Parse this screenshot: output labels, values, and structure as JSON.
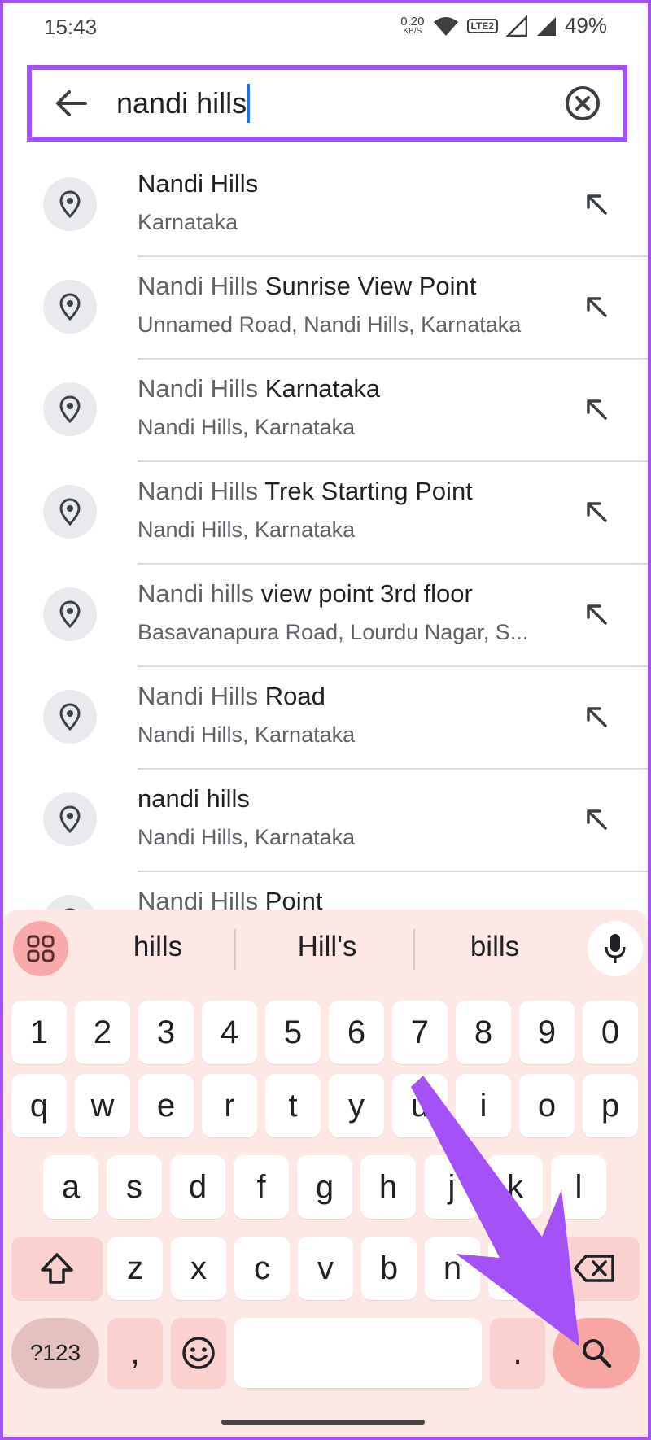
{
  "status_bar": {
    "time": "15:43",
    "net_speed": "0.20",
    "net_unit": "KB/S",
    "volte_label": "LTE2",
    "battery": "49%"
  },
  "search": {
    "query": "nandi hills"
  },
  "results": [
    {
      "match": "",
      "title": "Nandi Hills",
      "subtitle": "Karnataka"
    },
    {
      "match": "Nandi Hills",
      "title": " Sunrise View Point",
      "subtitle": "Unnamed Road, Nandi Hills, Karnataka"
    },
    {
      "match": "Nandi Hills",
      "title": " Karnataka",
      "subtitle": "Nandi Hills, Karnataka"
    },
    {
      "match": "Nandi Hills",
      "title": " Trek Starting Point",
      "subtitle": "Nandi Hills, Karnataka"
    },
    {
      "match": "Nandi hills",
      "title": " view point 3rd floor",
      "subtitle": "Basavanapura Road, Lourdu Nagar, S..."
    },
    {
      "match": "Nandi Hills",
      "title": " Road",
      "subtitle": "Nandi Hills, Karnataka"
    },
    {
      "match": "",
      "title": "nandi hills",
      "subtitle": "Nandi Hills, Karnataka"
    },
    {
      "match": "Nandi Hills",
      "title": " Point",
      "subtitle": ""
    }
  ],
  "keyboard": {
    "suggestions": [
      "hills",
      "Hill's",
      "bills"
    ],
    "numbers": [
      "1",
      "2",
      "3",
      "4",
      "5",
      "6",
      "7",
      "8",
      "9",
      "0"
    ],
    "row1": [
      "q",
      "w",
      "e",
      "r",
      "t",
      "y",
      "u",
      "i",
      "o",
      "p"
    ],
    "row2": [
      "a",
      "s",
      "d",
      "f",
      "g",
      "h",
      "j",
      "k",
      "l"
    ],
    "row3": [
      "z",
      "x",
      "c",
      "v",
      "b",
      "n",
      "m"
    ],
    "symbols_label": "?123",
    "comma": ",",
    "period": "."
  },
  "colors": {
    "highlight": "#a451f7",
    "keyboard_bg": "#fde8e6",
    "enter_key": "#f7a6a3"
  }
}
